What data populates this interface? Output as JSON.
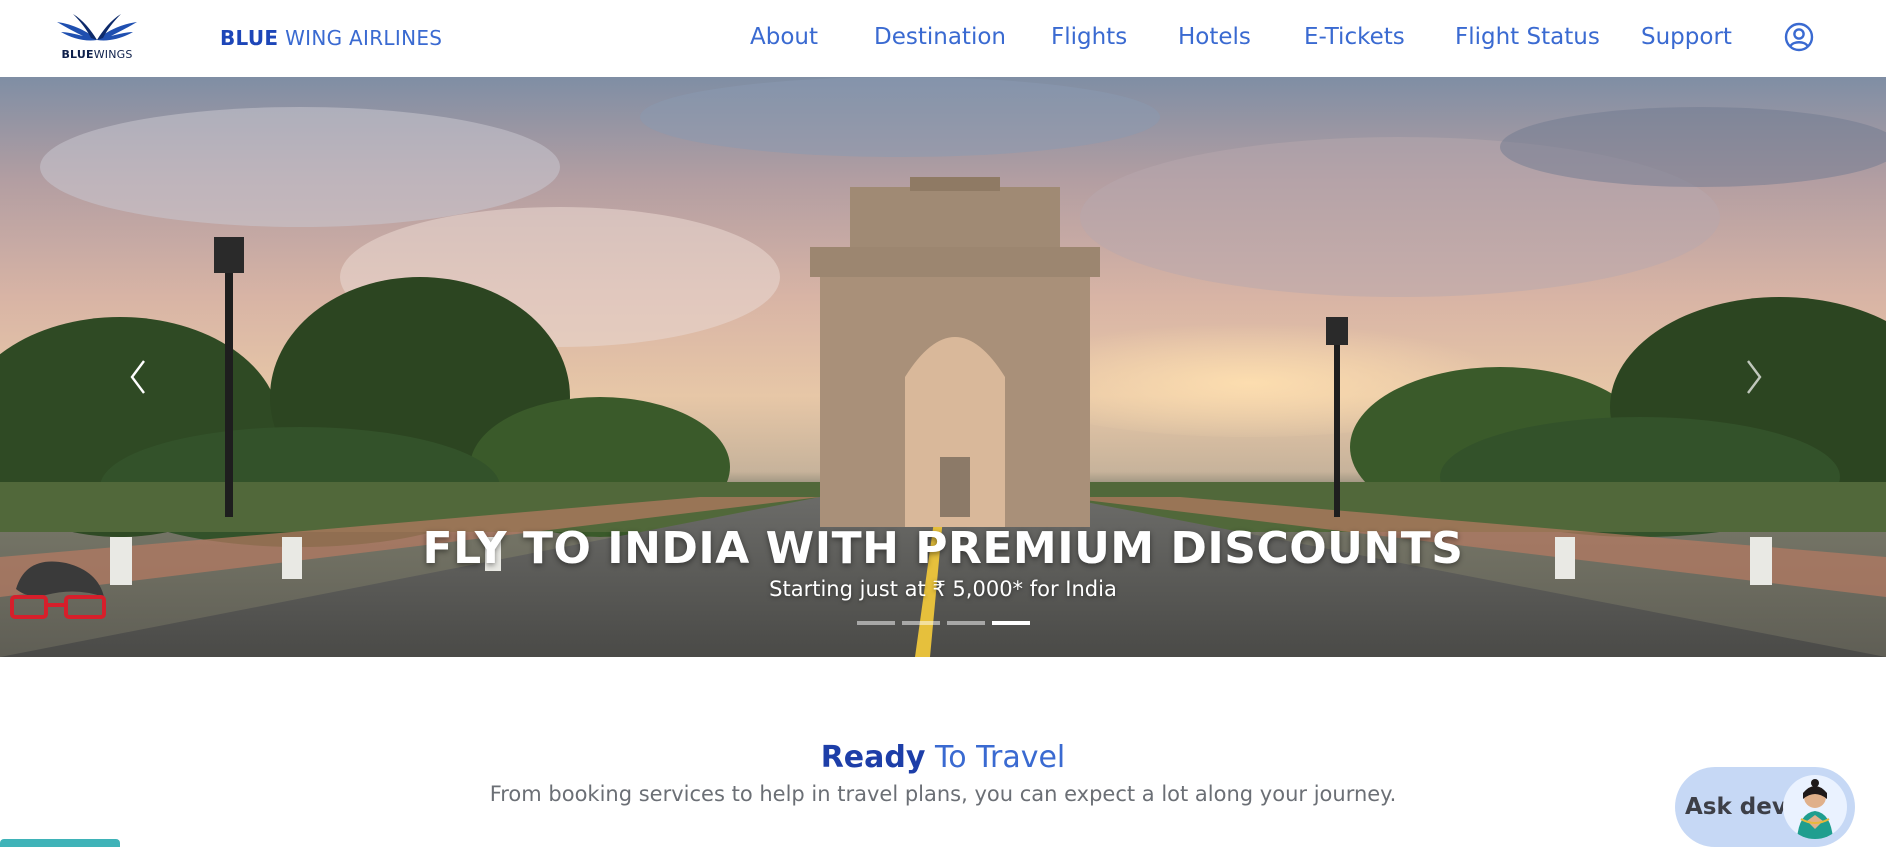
{
  "header": {
    "logo_text_bold": "BLUE",
    "logo_text_light": "WINGS",
    "brand_bold": "BLUE",
    "brand_light": "WING AIRLINES",
    "nav": [
      {
        "label": "About",
        "icon": null
      },
      {
        "label": "Destination",
        "icon": null
      },
      {
        "label": "Flights",
        "icon": null
      },
      {
        "label": "Hotels",
        "icon": null
      },
      {
        "label": "E-Tickets",
        "icon": null
      },
      {
        "label": "Flight Status",
        "icon": null
      },
      {
        "label": "Support",
        "icon": null
      }
    ],
    "user_icon": "user-circle-icon"
  },
  "hero": {
    "title": "FLY TO INDIA WITH PREMIUM DISCOUNTS",
    "subtitle": "Starting just at ₹ 5,000* for India",
    "slides_count": 4,
    "active_slide": 4,
    "prev_icon": "chevron-left-icon",
    "next_icon": "chevron-right-icon"
  },
  "ready": {
    "title_bold": "Ready",
    "title_rest": " To Travel",
    "subtitle": "From booking services to help in travel plans, you can expect a lot along your journey."
  },
  "assistant": {
    "label": "Ask devi"
  },
  "colors": {
    "accent": "#3a6ad1",
    "accent_dark": "#1d3ea8",
    "muted_text": "#6b6f75",
    "assistant_bg": "#c6d8f5",
    "teal": "#3fb3b8"
  }
}
